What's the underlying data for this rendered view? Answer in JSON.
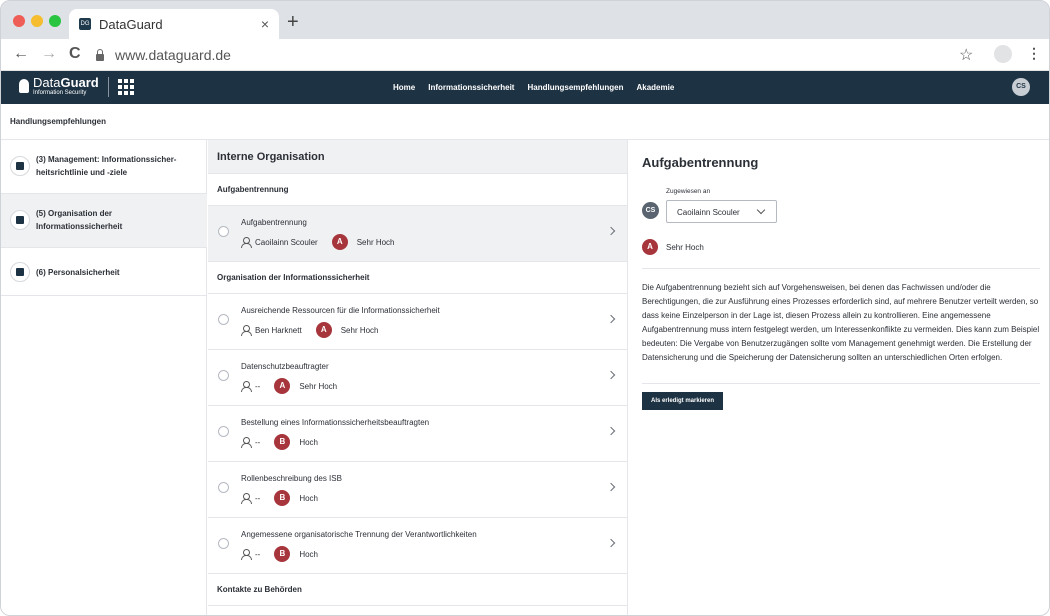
{
  "browser": {
    "tab_title": "DataGuard",
    "tab_close": "×",
    "new_tab": "+",
    "url": "www.dataguard.de",
    "back": "←",
    "forward": "→",
    "reload": "C",
    "star": "☆",
    "menu": "⋮"
  },
  "app": {
    "logo_main_a": "Data",
    "logo_main_b": "Guard",
    "logo_sub": "Information Security",
    "nav": [
      "Home",
      "Informationssicherheit",
      "Handlungsempfehlungen",
      "Akademie"
    ],
    "user_initials": "CS",
    "colors": {
      "header": "#1d3243",
      "priority": "#a7353c"
    }
  },
  "breadcrumb": "Handlungsempfehlungen",
  "categories": [
    {
      "label": "(3) Management: Informationssicher-heitsrichtlinie und -ziele",
      "active": false,
      "icon": "management-icon"
    },
    {
      "label": "(5) Organisation der Informationssicherheit",
      "active": true,
      "icon": "organisation-icon"
    },
    {
      "label": "(6) Personalsicherheit",
      "active": false,
      "icon": "people-icon"
    }
  ],
  "middle": {
    "title": "Interne Organisation",
    "sections": [
      "Aufgabentrennung",
      "Organisation der Informationssicherheit",
      "Kontakte zu Behörden"
    ],
    "tasks": [
      {
        "title": "Aufgabentrennung",
        "assignee": "Caoilainn Scouler",
        "priority_letter": "A",
        "priority": "Sehr Hoch"
      },
      {
        "title": "Ausreichende Ressourcen für die Informationssicherheit",
        "assignee": "Ben Harknett",
        "priority_letter": "A",
        "priority": "Sehr Hoch"
      },
      {
        "title": "Datenschutzbeauftragter",
        "assignee": "--",
        "priority_letter": "A",
        "priority": "Sehr Hoch"
      },
      {
        "title": "Bestellung eines Informationssicherheitsbeauftragten",
        "assignee": "--",
        "priority_letter": "B",
        "priority": "Hoch"
      },
      {
        "title": "Rollenbeschreibung des ISB",
        "assignee": "--",
        "priority_letter": "B",
        "priority": "Hoch"
      },
      {
        "title": "Angemessene organisatorische Trennung der Verantwortlichkeiten",
        "assignee": "--",
        "priority_letter": "B",
        "priority": "Hoch"
      }
    ]
  },
  "detail": {
    "title": "Aufgabentrennung",
    "assigned_label": "Zugewiesen an",
    "assignee_initials": "CS",
    "assignee": "Caoilainn Scouler",
    "priority_letter": "A",
    "priority": "Sehr Hoch",
    "description": "Die Aufgabentrennung bezieht sich auf Vorgehensweisen, bei denen das Fachwissen und/oder die Berechtigungen, die zur Ausführung eines Prozesses erforderlich sind, auf mehrere Benutzer verteilt werden, so dass keine Einzelperson in der Lage ist, diesen Prozess allein zu kontrollieren. Eine angemessene Aufgabentrennung muss intern festgelegt werden, um Interessenkonflikte zu vermeiden. Dies kann zum Beispiel bedeuten: Die Vergabe von Benutzerzugängen sollte vom Management genehmigt werden. Die Erstellung der Datensicherung und die Speicherung der Datensicherung sollten an unterschiedlichen Orten erfolgen.",
    "done_button": "Als erledigt markieren"
  }
}
